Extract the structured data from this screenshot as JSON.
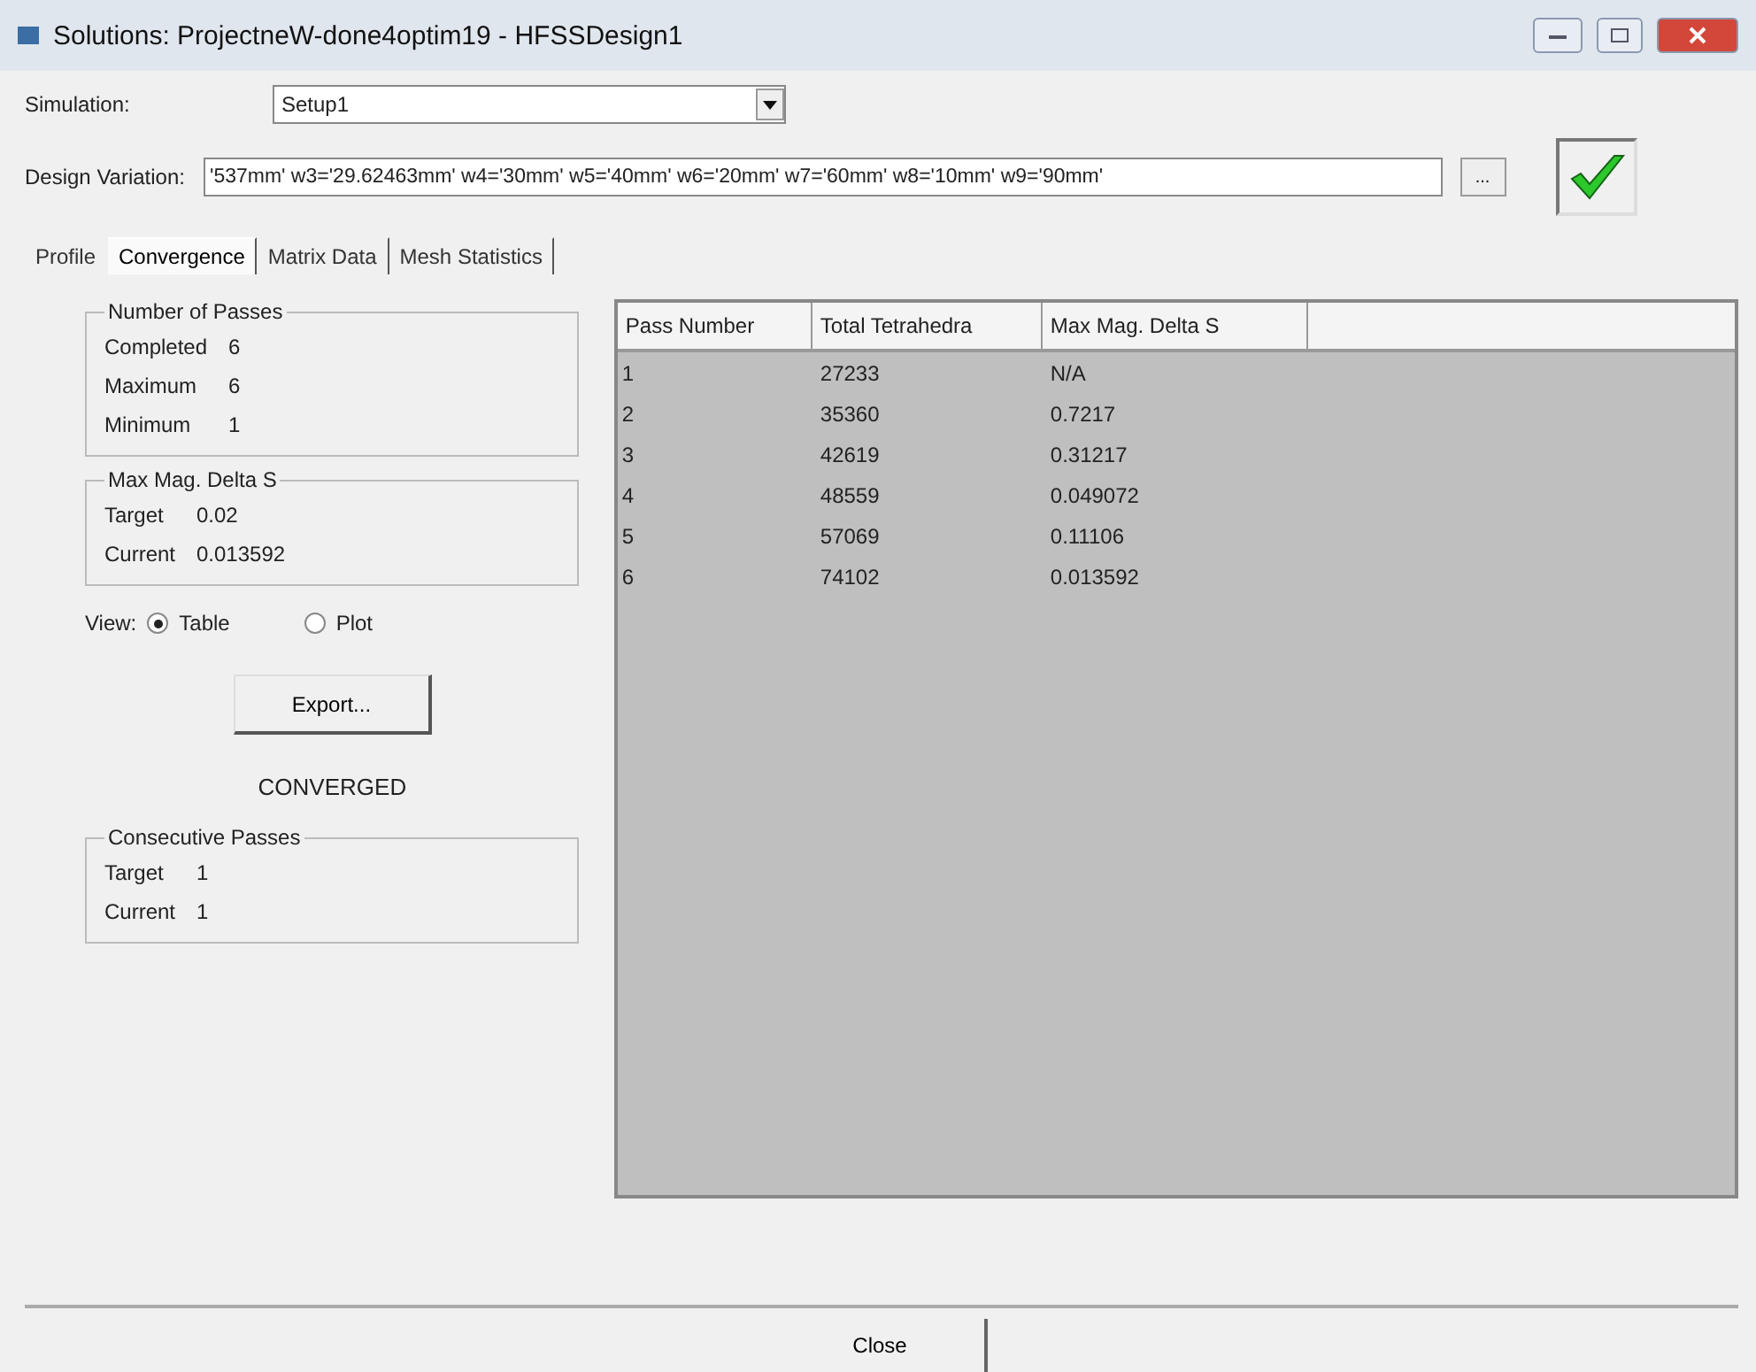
{
  "window": {
    "title": "Solutions: ProjectneW-done4optim19 - HFSSDesign1"
  },
  "simulation": {
    "label": "Simulation:",
    "value": "Setup1"
  },
  "design_variation": {
    "label": "Design Variation:",
    "value": "'537mm' w3='29.62463mm' w4='30mm' w5='40mm' w6='20mm' w7='60mm' w8='10mm' w9='90mm'",
    "button": "...",
    "ok": true
  },
  "tabs": [
    {
      "label": "Profile",
      "selected": false
    },
    {
      "label": "Convergence",
      "selected": true
    },
    {
      "label": "Matrix Data",
      "selected": false
    },
    {
      "label": "Mesh Statistics",
      "selected": false
    }
  ],
  "passes": {
    "title": "Number of Passes",
    "rows": [
      {
        "label": "Completed",
        "value": "6"
      },
      {
        "label": "Maximum",
        "value": "6"
      },
      {
        "label": "Minimum",
        "value": "1"
      }
    ]
  },
  "delta": {
    "title": "Max Mag. Delta S",
    "rows": [
      {
        "label": "Target",
        "value": "0.02"
      },
      {
        "label": "Current",
        "value": "0.013592"
      }
    ]
  },
  "view": {
    "label": "View:",
    "options": [
      {
        "label": "Table",
        "selected": true
      },
      {
        "label": "Plot",
        "selected": false
      }
    ]
  },
  "export_button": "Export...",
  "status": "CONVERGED",
  "consecutive": {
    "title": "Consecutive Passes",
    "rows": [
      {
        "label": "Target",
        "value": "1"
      },
      {
        "label": "Current",
        "value": "1"
      }
    ]
  },
  "table": {
    "columns": [
      "Pass Number",
      "Total Tetrahedra",
      "Max Mag. Delta S"
    ],
    "rows": [
      [
        "1",
        "27233",
        "N/A"
      ],
      [
        "2",
        "35360",
        "0.7217"
      ],
      [
        "3",
        "42619",
        "0.31217"
      ],
      [
        "4",
        "48559",
        "0.049072"
      ],
      [
        "5",
        "57069",
        "0.11106"
      ],
      [
        "6",
        "74102",
        "0.013592"
      ]
    ]
  },
  "close_button": "Close"
}
